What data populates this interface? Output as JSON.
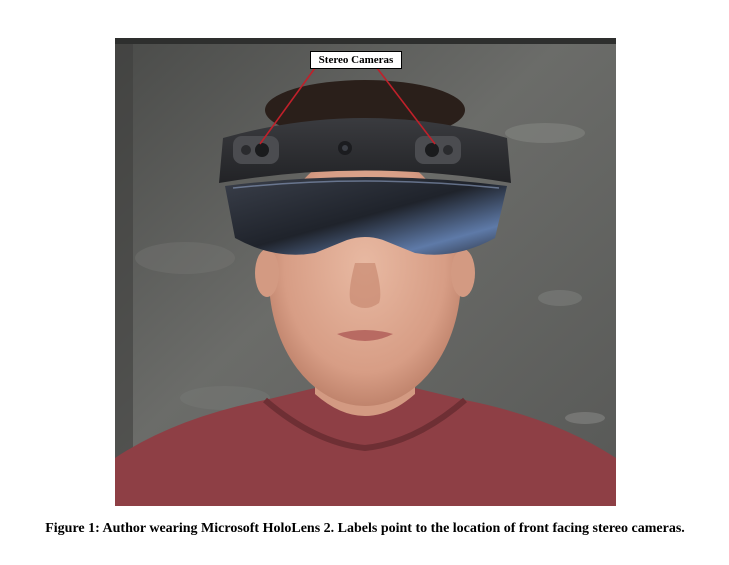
{
  "figure": {
    "label": "Stereo Cameras",
    "caption": "Figure 1: Author wearing Microsoft HoloLens 2. Labels point to the location of front facing stereo cameras."
  },
  "colors": {
    "label_line": "#c0202a",
    "shirt": "#8e3f45",
    "chalkboard": "#5d5e5c",
    "headset": "#2b2c2f"
  }
}
